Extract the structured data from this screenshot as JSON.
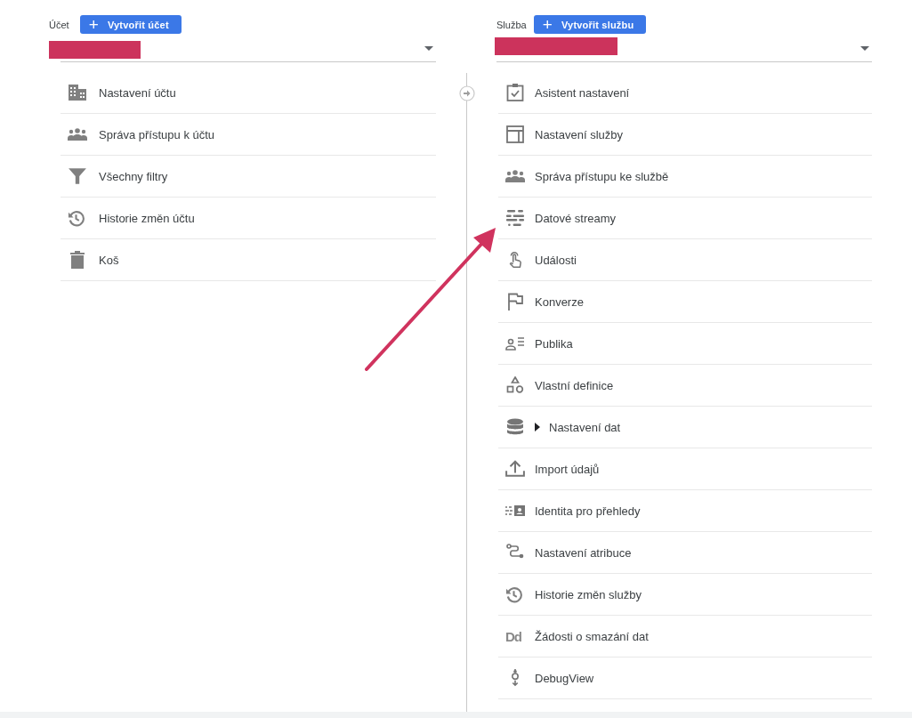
{
  "account": {
    "label": "Účet",
    "create_button": {
      "icon": "+",
      "label": "Vytvořit účet"
    },
    "items": [
      {
        "label": "Nastavení účtu"
      },
      {
        "label": "Správa přístupu k účtu"
      },
      {
        "label": "Všechny filtry"
      },
      {
        "label": "Historie změn účtu"
      },
      {
        "label": "Koš"
      }
    ]
  },
  "property": {
    "label": "Služba",
    "create_button": {
      "icon": "+",
      "label": "Vytvořit službu"
    },
    "items": [
      {
        "label": "Asistent nastavení"
      },
      {
        "label": "Nastavení služby"
      },
      {
        "label": "Správa přístupu ke službě"
      },
      {
        "label": "Datové streamy"
      },
      {
        "label": "Události"
      },
      {
        "label": "Konverze"
      },
      {
        "label": "Publika"
      },
      {
        "label": "Vlastní definice"
      },
      {
        "label": "Nastavení dat",
        "expanded": false
      },
      {
        "label": "Import údajů"
      },
      {
        "label": "Identita pro přehledy"
      },
      {
        "label": "Nastavení atribuce"
      },
      {
        "label": "Historie změn služby"
      },
      {
        "label": "Žádosti o smazání dat",
        "icon_text": "Dd"
      },
      {
        "label": "DebugView"
      }
    ]
  }
}
